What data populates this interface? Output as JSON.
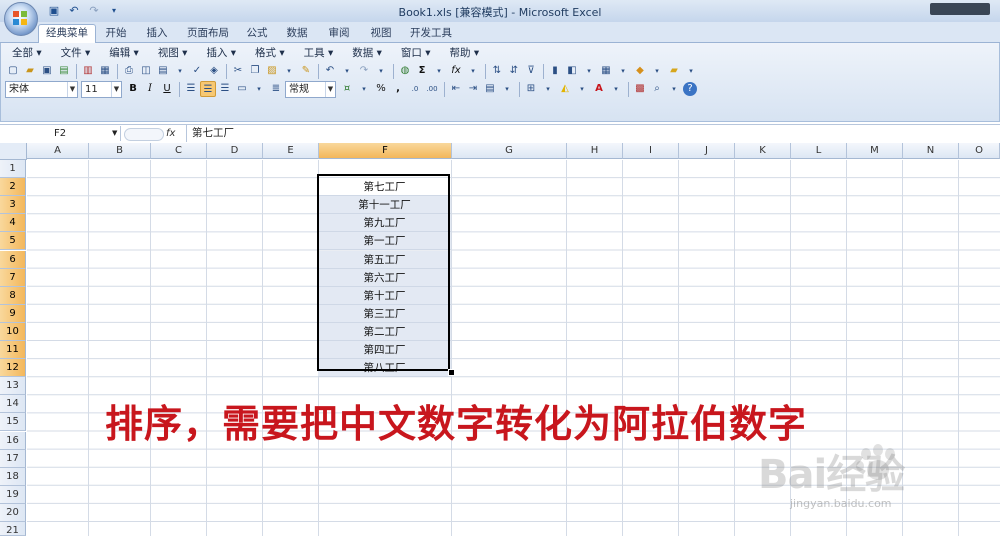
{
  "window": {
    "title": "Book1.xls  [兼容模式] - Microsoft Excel"
  },
  "ribbon": {
    "tabs": [
      "经典菜单",
      "开始",
      "插入",
      "页面布局",
      "公式",
      "数据",
      "审阅",
      "视图",
      "开发工具"
    ],
    "active_tab": "经典菜单",
    "menus": [
      "全部 ▾",
      "文件 ▾",
      "编辑 ▾",
      "视图 ▾",
      "插入 ▾",
      "格式 ▾",
      "工具 ▾",
      "数据 ▾",
      "窗口 ▾",
      "帮助 ▾"
    ],
    "font_name": "宋体",
    "font_size": "11",
    "number_format": "常规",
    "bold_label": "B",
    "italic_label": "I",
    "underline_label": "U",
    "percent_label": "%",
    "comma_label": ",",
    "sum_label": "Σ",
    "fx_label": "fx"
  },
  "formula_bar": {
    "name_box": "F2",
    "fx_label": "fx",
    "content": "第七工厂"
  },
  "grid": {
    "columns": [
      "A",
      "B",
      "C",
      "D",
      "E",
      "F",
      "G",
      "H",
      "I",
      "J",
      "K",
      "L",
      "M",
      "N",
      "O"
    ],
    "selected_column": "F",
    "rows": [
      "1",
      "2",
      "3",
      "4",
      "5",
      "6",
      "7",
      "8",
      "9",
      "10",
      "11",
      "12",
      "13",
      "14",
      "15",
      "16",
      "17",
      "18",
      "19",
      "20",
      "21"
    ],
    "selected_rows": [
      "2",
      "3",
      "4",
      "5",
      "6",
      "7",
      "8",
      "9",
      "10",
      "11",
      "12"
    ],
    "column_f_cells": [
      "第七工厂",
      "第十一工厂",
      "第九工厂",
      "第一工厂",
      "第五工厂",
      "第六工厂",
      "第十工厂",
      "第三工厂",
      "第二工厂",
      "第四工厂",
      "第八工厂"
    ]
  },
  "annotation": {
    "text": "排序，需要把中文数字转化为阿拉伯数字",
    "color": "#c8161d"
  },
  "watermark": {
    "logo_text": "Bai经验",
    "url": "jingyan.baidu.com"
  }
}
